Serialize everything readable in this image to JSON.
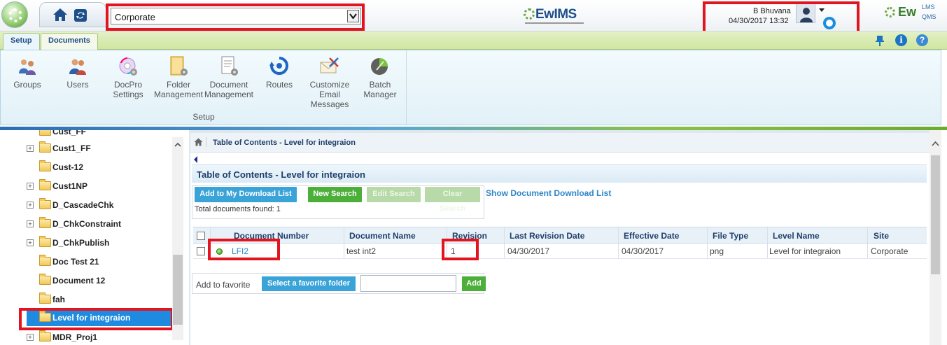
{
  "topbar": {
    "site_selected": "Corporate",
    "brand_center": "EwIMS",
    "user_name": "B Bhuvana",
    "datetime": "04/30/2017 13:32",
    "brand_right": "Ew",
    "brand_right_lms": "LMS",
    "brand_right_qms": "QMS"
  },
  "ribbon": {
    "tabs": [
      "Setup",
      "Documents"
    ],
    "buttons": [
      {
        "label": "Groups",
        "icon": "groups-icon"
      },
      {
        "label": "Users",
        "icon": "users-icon"
      },
      {
        "label": "DocPro Settings",
        "icon": "docpro-settings-icon"
      },
      {
        "label": "Folder Management",
        "icon": "folder-management-icon"
      },
      {
        "label": "Document Management",
        "icon": "document-management-icon"
      },
      {
        "label": "Routes",
        "icon": "routes-icon"
      },
      {
        "label": "Customize Email Messages",
        "icon": "email-icon"
      },
      {
        "label": "Batch Manager",
        "icon": "batch-manager-icon"
      }
    ],
    "group_label": "Setup"
  },
  "tree": {
    "items": [
      {
        "name": "Cust_FF",
        "expandable": false
      },
      {
        "name": "Cust1_FF",
        "expandable": true
      },
      {
        "name": "Cust-12",
        "expandable": false
      },
      {
        "name": "Cust1NP",
        "expandable": true
      },
      {
        "name": "D_CascadeChk",
        "expandable": true
      },
      {
        "name": "D_ChkConstraint",
        "expandable": true
      },
      {
        "name": "D_ChkPublish",
        "expandable": true
      },
      {
        "name": "Doc Test 21",
        "expandable": false
      },
      {
        "name": "Document 12",
        "expandable": false
      },
      {
        "name": "fah",
        "expandable": false
      },
      {
        "name": "Level for integraion",
        "expandable": false,
        "selected": true
      },
      {
        "name": "MDR_Proj1",
        "expandable": true
      }
    ]
  },
  "main": {
    "breadcrumb": "Table of Contents - Level for integraion",
    "title": "Table of Contents - Level for integraion",
    "buttons": {
      "download": "Add to My Download List",
      "new_search": "New Search",
      "edit_search": "Edit Search",
      "clear_search": "Clear Search"
    },
    "show_download_link": "Show Document Download List",
    "total_found": "Total documents found: 1",
    "table": {
      "columns": [
        "Document Number",
        "Document Name",
        "Revision",
        "Last Revision Date",
        "Effective Date",
        "File Type",
        "Level Name",
        "Site"
      ],
      "rows": [
        {
          "document_number": "LFI2",
          "document_name": "test int2",
          "revision": "1",
          "last_revision_date": "04/30/2017",
          "effective_date": "04/30/2017",
          "file_type": "png",
          "level_name": "Level for integraion",
          "site": "Corporate"
        }
      ]
    },
    "favorite": {
      "label": "Add to favorite",
      "select_button": "Select a favorite folder",
      "input_value": "",
      "add_button": "Add"
    }
  },
  "colors": {
    "highlight_box": "#e2141f",
    "selection": "#1f8be0",
    "primary_button": "#3aa3d8",
    "success_button": "#4caf3a",
    "link": "#2e86c8"
  }
}
